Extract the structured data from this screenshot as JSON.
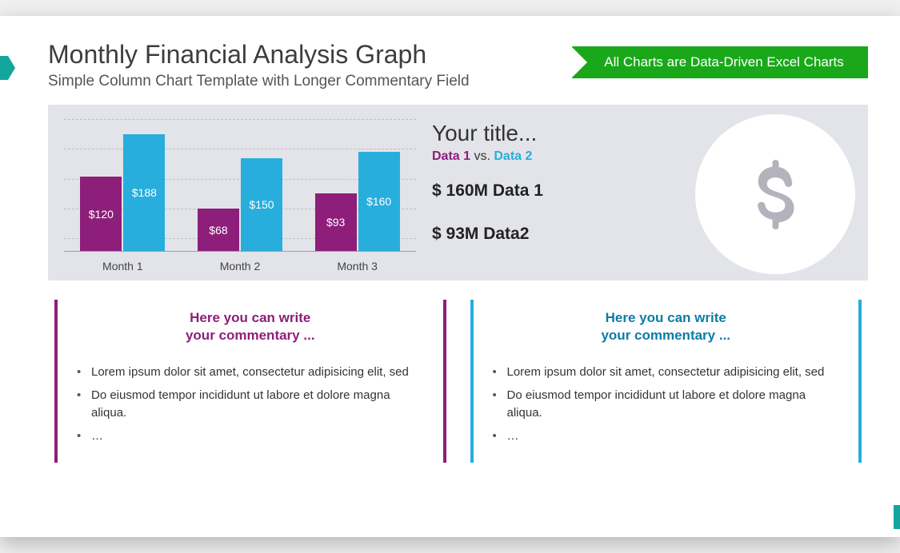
{
  "header": {
    "title": "Monthly Financial Analysis Graph",
    "subtitle": "Simple Column Chart Template with Longer Commentary Field",
    "ribbon": "All Charts are Data-Driven Excel Charts"
  },
  "info": {
    "title": "Your title...",
    "sub_d1": "Data 1",
    "sub_vs": " vs. ",
    "sub_d2": "Data 2",
    "stat1": "$ 160M Data 1",
    "stat2": "$ 93M Data2"
  },
  "chart_data": {
    "type": "bar",
    "categories": [
      "Month 1",
      "Month 2",
      "Month 3"
    ],
    "series": [
      {
        "name": "Data 1",
        "color": "#8d1f7a",
        "values": [
          120,
          68,
          93
        ],
        "labels": [
          "$120",
          "$68",
          "$93"
        ]
      },
      {
        "name": "Data 2",
        "color": "#28aedc",
        "values": [
          188,
          150,
          160
        ],
        "labels": [
          "$188",
          "$150",
          "$160"
        ]
      }
    ],
    "ylim": [
      0,
      200
    ],
    "title": "",
    "xlabel": "",
    "ylabel": ""
  },
  "commentary": {
    "left": {
      "head_l1": "Here you can write",
      "head_l2": "your commentary ...",
      "items": [
        "Lorem ipsum dolor sit amet, consectetur adipisicing elit, sed",
        "Do eiusmod tempor incididunt ut labore et dolore magna aliqua.",
        "…"
      ]
    },
    "right": {
      "head_l1": "Here you can write",
      "head_l2": "your commentary ...",
      "items": [
        "Lorem ipsum dolor sit amet, consectetur adipisicing elit, sed",
        "Do eiusmod tempor incididunt ut labore et dolore magna aliqua.",
        "…"
      ]
    }
  },
  "colors": {
    "purple": "#8d1f7a",
    "blue": "#28aedc",
    "green": "#1aa81a",
    "teal": "#14a69e"
  }
}
